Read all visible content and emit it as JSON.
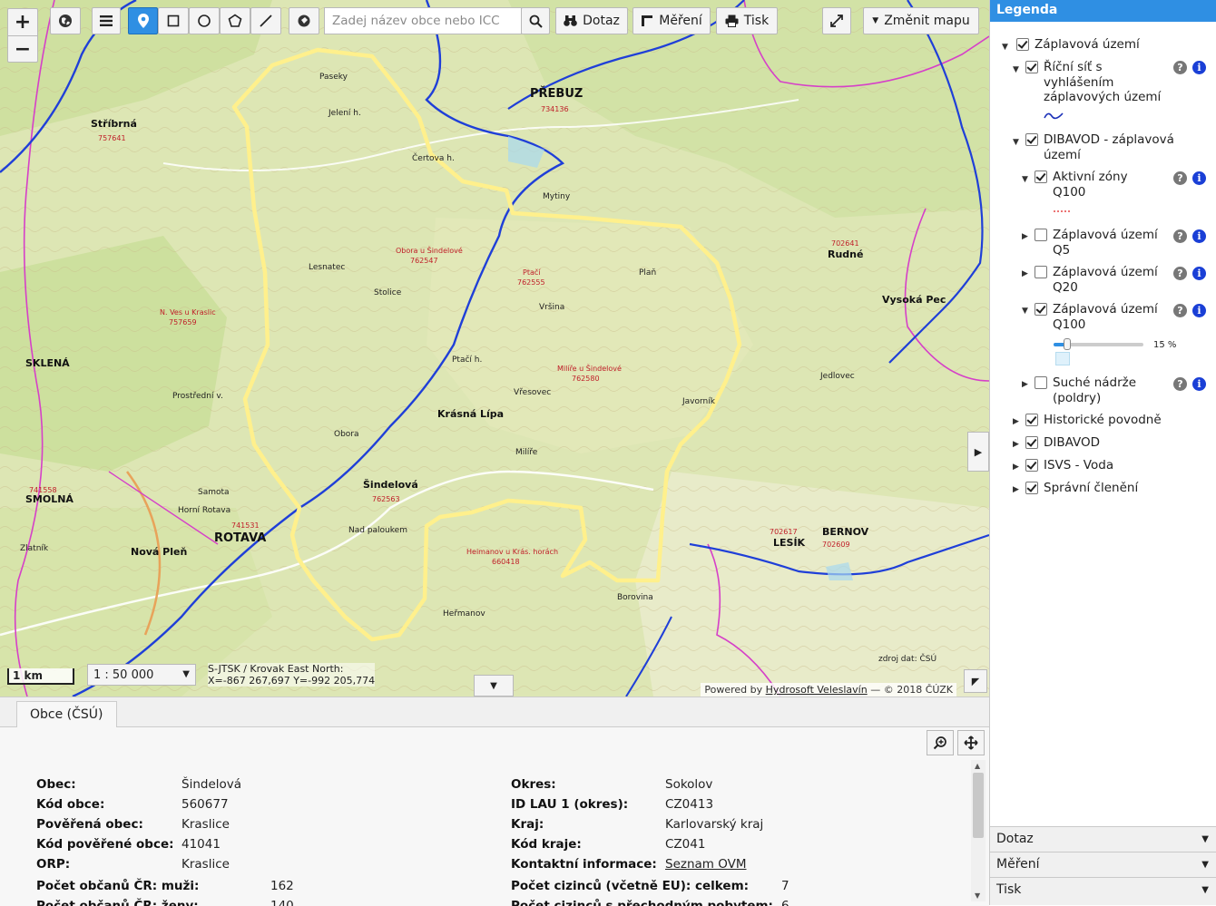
{
  "toolbar": {
    "zoom_in": "+",
    "zoom_out": "−",
    "search_placeholder": "Zadej název obce nebo ICC",
    "query_label": "Dotaz",
    "measure_label": "Měření",
    "print_label": "Tisk",
    "change_map_label": "Změnit mapu"
  },
  "map": {
    "scale_bar": "1 km",
    "scale": "1 : 50 000",
    "coord_system": "S-JTSK / Krovak East North:",
    "coords": "X=-867 267,697 Y=-992 205,774",
    "credit_prefix": "Powered by",
    "credit_link": "Hydrosoft Veleslavín",
    "credit_suffix": "— © 2018 ČÚZK",
    "source_note": "zdroj dat: ČSÚ",
    "places": [
      {
        "name": "PŘEBUZ",
        "class": "big",
        "sub": "734136"
      },
      {
        "name": "Stříbrná",
        "class": "mid",
        "sub": "757641"
      },
      {
        "name": "Šindelová",
        "class": "mid",
        "sub": "762563"
      },
      {
        "name": "ROTAVA",
        "class": "big",
        "sub": "741531"
      },
      {
        "name": "Nová Pleň",
        "class": "mid"
      },
      {
        "name": "Krásná Lípa",
        "class": "mid"
      },
      {
        "name": "Vysoká Pec",
        "class": "mid"
      },
      {
        "name": "SMOLNÁ",
        "class": "mid",
        "sub": "741558"
      },
      {
        "name": "Rudné",
        "class": "mid",
        "sub": "702641"
      },
      {
        "name": "BERNOV",
        "class": "mid",
        "sub": "702609"
      },
      {
        "name": "LESÍK",
        "class": "mid",
        "sub": "702617"
      },
      {
        "name": "SKLENÁ",
        "class": "mid"
      },
      {
        "name": "Horní Rotava",
        "class": "hill"
      },
      {
        "name": "Samota",
        "class": "hill"
      },
      {
        "name": "Heřmanov",
        "class": "hill"
      },
      {
        "name": "Borovina",
        "class": "hill"
      },
      {
        "name": "Mytiny",
        "class": "hill"
      },
      {
        "name": "Paseky",
        "class": "hill"
      },
      {
        "name": "Obora",
        "class": "hill"
      },
      {
        "name": "Milíře",
        "class": "hill"
      },
      {
        "name": "Nad paloukem",
        "class": "hill"
      },
      {
        "name": "Ptačí h.",
        "class": "hill"
      },
      {
        "name": "Lesnatec",
        "class": "hill"
      },
      {
        "name": "Stolice",
        "class": "hill"
      },
      {
        "name": "Plaň",
        "class": "hill"
      },
      {
        "name": "Javorník",
        "class": "hill"
      },
      {
        "name": "Jelení h.",
        "class": "hill"
      },
      {
        "name": "Čertova h.",
        "class": "hill"
      },
      {
        "name": "Vřesovec",
        "class": "hill"
      },
      {
        "name": "Vršina",
        "class": "hill"
      },
      {
        "name": "Jedlovec",
        "class": "hill"
      },
      {
        "name": "Zlatník",
        "class": "hill"
      },
      {
        "name": "Prostřední v.",
        "class": "hill"
      },
      {
        "name": "Ptačí",
        "class": "red",
        "sub": "762555"
      },
      {
        "name": "Obora u Šindelové",
        "class": "red",
        "sub": "762547"
      },
      {
        "name": "Milíře u Šindelové",
        "class": "red",
        "sub": "762580"
      },
      {
        "name": "Heimanov u Krás. horách",
        "class": "red",
        "sub": "660418"
      },
      {
        "name": "N. Ves u Kraslic",
        "class": "red",
        "sub": "757659"
      }
    ]
  },
  "panel": {
    "tab": "Obce (ČSÚ)",
    "left": [
      {
        "key": "Obec:",
        "value": "Šindelová"
      },
      {
        "key": "Kód obce:",
        "value": "560677"
      },
      {
        "key": "Pověřená obec:",
        "value": "Kraslice"
      },
      {
        "key": "Kód pověřené obce:",
        "value": "41041"
      },
      {
        "key": "ORP:",
        "value": "Kraslice"
      },
      {
        "key": "Počet občanů ČR: muži:",
        "value": "162"
      },
      {
        "key": "Počet občanů ČR: ženy:",
        "value": "140"
      }
    ],
    "right": [
      {
        "key": "Okres:",
        "value": "Sokolov"
      },
      {
        "key": "ID LAU 1 (okres):",
        "value": "CZ0413"
      },
      {
        "key": "Kraj:",
        "value": "Karlovarský kraj"
      },
      {
        "key": "Kód kraje:",
        "value": "CZ041"
      },
      {
        "key": "Kontaktní informace:",
        "value": "Seznam OVM"
      },
      {
        "key": "Počet cizinců (včetně EU): celkem:",
        "value": "7"
      },
      {
        "key": "Počet cizinců s přechodným pobytem:",
        "value": "6"
      }
    ]
  },
  "legend": {
    "title": "Legenda",
    "items": [
      {
        "label": "Záplavová území"
      },
      {
        "label": "Říční síť s vyhlášením záplavových území"
      },
      {
        "label": "DIBAVOD - záplavová území"
      },
      {
        "label": "Aktivní zóny Q100"
      },
      {
        "label": "Záplavová území Q5"
      },
      {
        "label": "Záplavová území Q20"
      },
      {
        "label": "Záplavová území Q100"
      },
      {
        "label": "Suché nádrže (poldry)"
      },
      {
        "label": "Historické povodně"
      },
      {
        "label": "DIBAVOD"
      },
      {
        "label": "ISVS - Voda"
      },
      {
        "label": "Správní členění"
      }
    ],
    "opacity": "15 %",
    "opacity_value": 0.15,
    "accordions": [
      "Dotaz",
      "Měření",
      "Tisk"
    ]
  },
  "colors": {
    "accent": "#2f8fe3",
    "boundary": "#fff08c",
    "river": "#1f3fd8",
    "admin_border": "#d640c8",
    "map_base": "#dde6b4"
  }
}
